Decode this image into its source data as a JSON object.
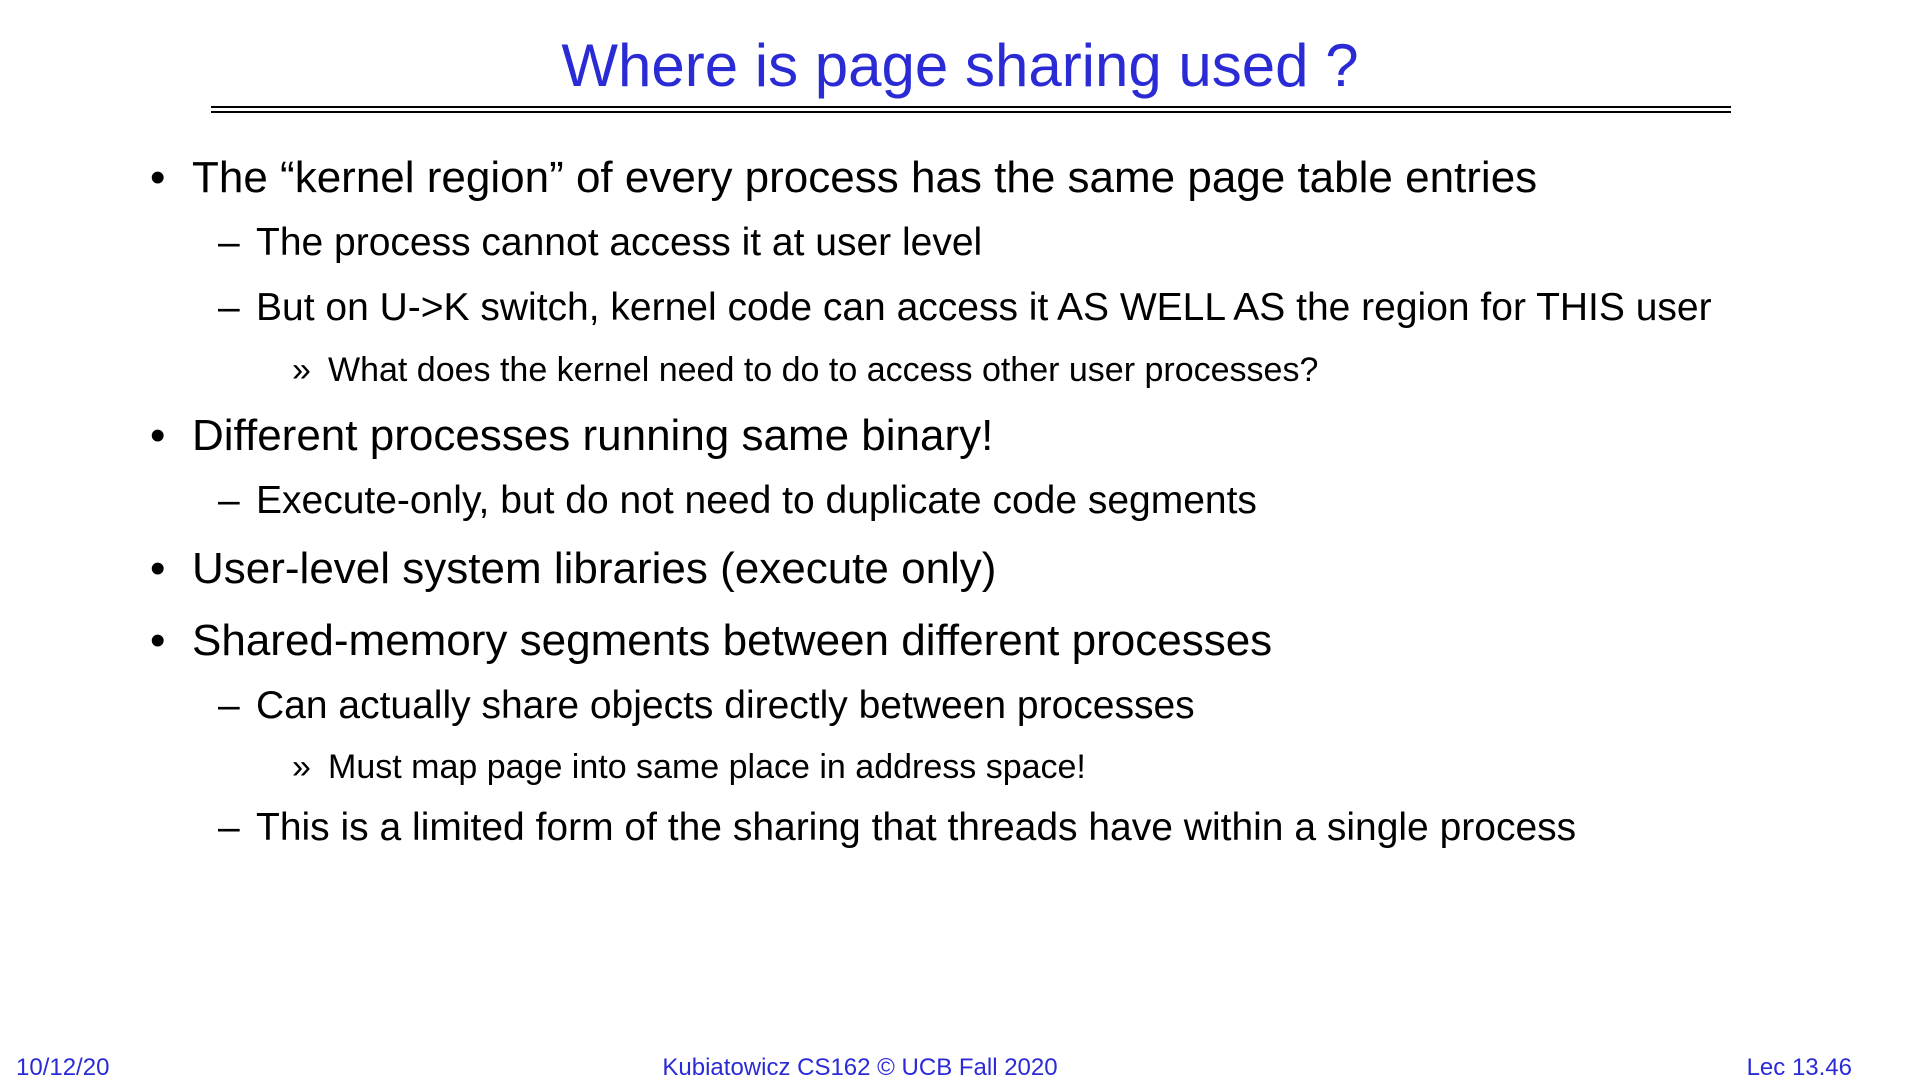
{
  "slide": {
    "title": "Where is page sharing used ?",
    "accent_color": "#2b2bd6",
    "bullet_glyph": "•",
    "dash_glyph": "–",
    "sub_glyph": "»",
    "items": [
      {
        "level": 1,
        "text": "The “kernel region” of every process has the same page table entries"
      },
      {
        "level": 2,
        "text": "The process cannot access it at user level"
      },
      {
        "level": 2,
        "text": "But on U->K switch, kernel code can access it AS WELL AS the region for THIS user"
      },
      {
        "level": 3,
        "text": "What does the kernel need to do to access other user processes?"
      },
      {
        "level": 1,
        "text": "Different processes running same binary!"
      },
      {
        "level": 2,
        "text": "Execute-only, but do not need to duplicate code segments"
      },
      {
        "level": 1,
        "text": "User-level system libraries (execute only)"
      },
      {
        "level": 1,
        "text": "Shared-memory segments between different processes"
      },
      {
        "level": 2,
        "text": "Can actually share objects directly between processes"
      },
      {
        "level": 3,
        "text": "Must map page into same place in address space!"
      },
      {
        "level": 2,
        "text": "This is a limited form of the sharing that threads have within a single process"
      }
    ]
  },
  "footer": {
    "date": "10/12/20",
    "course": "Kubiatowicz CS162 © UCB Fall 2020",
    "lecture": "Lec 13.46"
  }
}
